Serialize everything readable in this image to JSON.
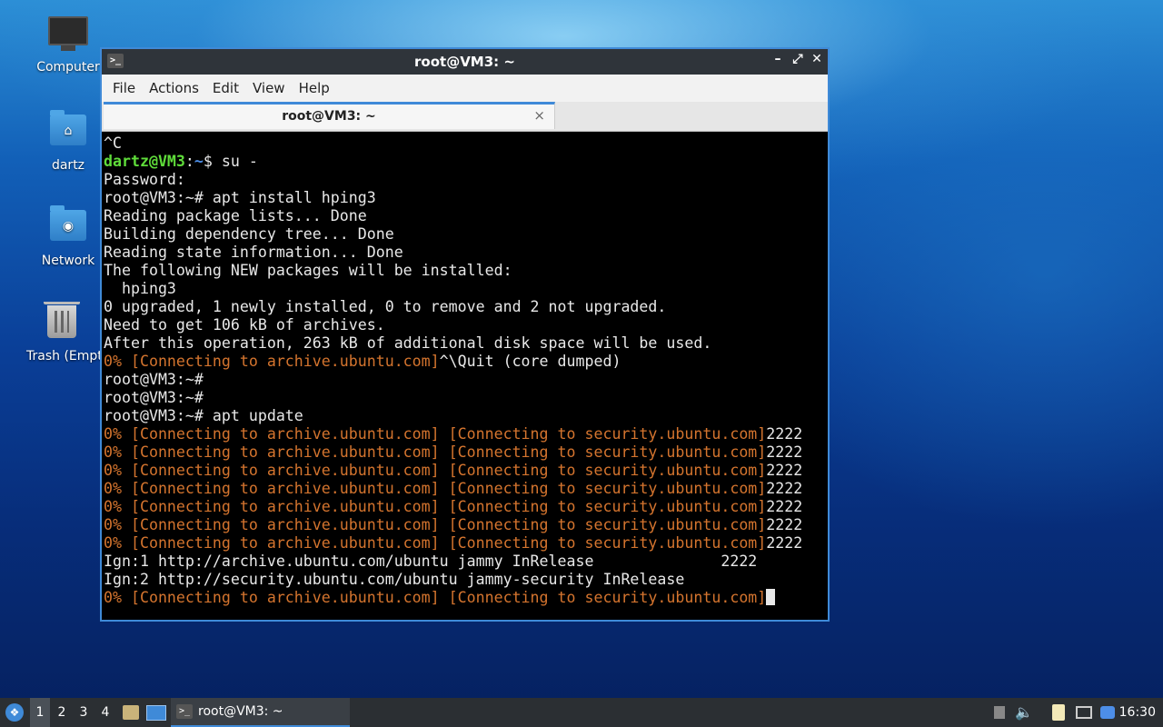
{
  "desktop": {
    "icons": [
      {
        "label": "Computer"
      },
      {
        "label": "dartz"
      },
      {
        "label": "Network"
      },
      {
        "label": "Trash (Empty)"
      }
    ]
  },
  "window": {
    "title": "root@VM3: ~",
    "menu": [
      "File",
      "Actions",
      "Edit",
      "View",
      "Help"
    ],
    "tab_title": "root@VM3: ~",
    "tab_close": "×"
  },
  "terminal": {
    "lines": [
      [
        {
          "t": "^C"
        }
      ],
      [
        {
          "t": "dartz@VM3",
          "c": "green"
        },
        {
          "t": ":"
        },
        {
          "t": "~",
          "c": "blue"
        },
        {
          "t": "$ su -"
        }
      ],
      [
        {
          "t": "Password:"
        }
      ],
      [
        {
          "t": "root@VM3:~# apt install hping3"
        }
      ],
      [
        {
          "t": "Reading package lists... Done"
        }
      ],
      [
        {
          "t": "Building dependency tree... Done"
        }
      ],
      [
        {
          "t": "Reading state information... Done"
        }
      ],
      [
        {
          "t": "The following NEW packages will be installed:"
        }
      ],
      [
        {
          "t": "  hping3"
        }
      ],
      [
        {
          "t": "0 upgraded, 1 newly installed, 0 to remove and 2 not upgraded."
        }
      ],
      [
        {
          "t": "Need to get 106 kB of archives."
        }
      ],
      [
        {
          "t": "After this operation, 263 kB of additional disk space will be used."
        }
      ],
      [
        {
          "t": "0% [Connecting to archive.ubuntu.com]",
          "c": "orange"
        },
        {
          "t": "^\\Quit (core dumped)"
        }
      ],
      [
        {
          "t": "root@VM3:~#"
        }
      ],
      [
        {
          "t": "root@VM3:~#"
        }
      ],
      [
        {
          "t": "root@VM3:~# apt update"
        }
      ],
      [
        {
          "t": "0% [Connecting to archive.ubuntu.com] [Connecting to security.ubuntu.com]",
          "c": "orange"
        },
        {
          "t": "2222"
        }
      ],
      [
        {
          "t": "0% [Connecting to archive.ubuntu.com] [Connecting to security.ubuntu.com]",
          "c": "orange"
        },
        {
          "t": "2222"
        }
      ],
      [
        {
          "t": "0% [Connecting to archive.ubuntu.com] [Connecting to security.ubuntu.com]",
          "c": "orange"
        },
        {
          "t": "2222"
        }
      ],
      [
        {
          "t": "0% [Connecting to archive.ubuntu.com] [Connecting to security.ubuntu.com]",
          "c": "orange"
        },
        {
          "t": "2222"
        }
      ],
      [
        {
          "t": "0% [Connecting to archive.ubuntu.com] [Connecting to security.ubuntu.com]",
          "c": "orange"
        },
        {
          "t": "2222"
        }
      ],
      [
        {
          "t": "0% [Connecting to archive.ubuntu.com] [Connecting to security.ubuntu.com]",
          "c": "orange"
        },
        {
          "t": "2222"
        }
      ],
      [
        {
          "t": "0% [Connecting to archive.ubuntu.com] [Connecting to security.ubuntu.com]",
          "c": "orange"
        },
        {
          "t": "2222"
        }
      ],
      [
        {
          "t": "Ign:1 http://archive.ubuntu.com/ubuntu jammy InRelease              2222"
        }
      ],
      [
        {
          "t": "Ign:2 http://security.ubuntu.com/ubuntu jammy-security InRelease"
        }
      ],
      [
        {
          "t": "0% [Connecting to archive.ubuntu.com] [Connecting to security.ubuntu.com]",
          "c": "orange"
        },
        {
          "cursor": true
        }
      ]
    ]
  },
  "taskbar": {
    "workspaces": [
      "1",
      "2",
      "3",
      "4"
    ],
    "task_label": "root@VM3: ~",
    "clock": "16:30"
  },
  "colors": {
    "accent": "#3f8ad8",
    "prompt_user": "#5fdc3a",
    "prompt_path": "#4d8ee8",
    "progress_text": "#d4742e"
  }
}
